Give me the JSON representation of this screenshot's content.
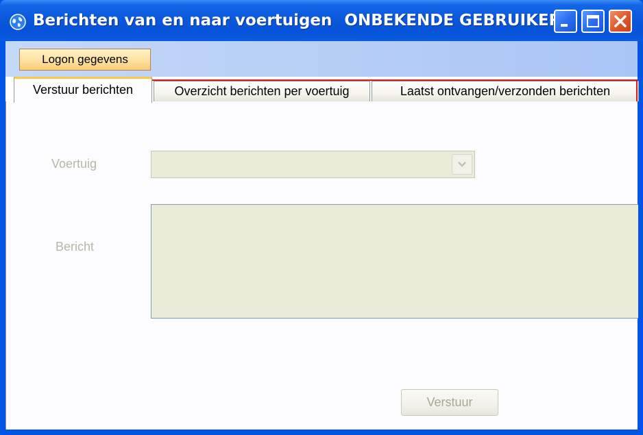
{
  "window": {
    "title": "Berichten van en naar voertuigen",
    "user": "ONBEKENDE GEBRUIKER"
  },
  "toolbar": {
    "logon_label": "Logon gegevens"
  },
  "tabs": [
    {
      "label": "Verstuur berichten",
      "active": true
    },
    {
      "label": "Overzicht berichten per voertuig",
      "active": false
    },
    {
      "label": "Laatst ontvangen/verzonden berichten",
      "active": false
    }
  ],
  "form": {
    "vehicle_label": "Voertuig",
    "vehicle_value": "",
    "message_label": "Bericht",
    "message_value": "",
    "send_label": "Verstuur"
  },
  "colors": {
    "titlebar": "#0a58dc",
    "highlight_tab": "#ffc83c",
    "disabled_text": "#b7b6a7",
    "red_accent": "#e01818"
  },
  "icons": {
    "app": "globe-icon",
    "minimize": "minimize-icon",
    "maximize": "maximize-icon",
    "close": "close-icon",
    "dropdown": "chevron-down-icon"
  }
}
